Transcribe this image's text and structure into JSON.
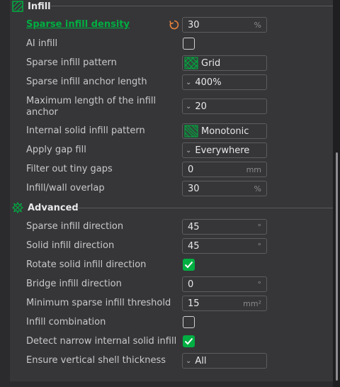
{
  "infill_section": {
    "title": "Infill",
    "accent": "#00ae42",
    "icon": "infill-section-icon"
  },
  "advanced_section": {
    "title": "Advanced",
    "icon": "advanced-section-icon"
  },
  "rows": {
    "sparse_density": {
      "label": "Sparse infill density",
      "value": "30",
      "unit": "%"
    },
    "ai_infill": {
      "label": "AI infill",
      "checked": false
    },
    "sparse_pattern": {
      "label": "Sparse infill pattern",
      "value": "Grid"
    },
    "anchor_length": {
      "label": "Sparse infill anchor length",
      "value": "400%"
    },
    "max_anchor": {
      "label": "Maximum length of the infill anchor",
      "value": "20"
    },
    "internal_solid_pattern": {
      "label": "Internal solid infill pattern",
      "value": "Monotonic"
    },
    "gap_fill": {
      "label": "Apply gap fill",
      "value": "Everywhere"
    },
    "tiny_gaps": {
      "label": "Filter out tiny gaps",
      "value": "0",
      "unit": "mm"
    },
    "wall_overlap": {
      "label": "Infill/wall overlap",
      "value": "30",
      "unit": "%"
    },
    "sparse_direction": {
      "label": "Sparse infill direction",
      "value": "45",
      "unit": "°"
    },
    "solid_direction": {
      "label": "Solid infill direction",
      "value": "45",
      "unit": "°"
    },
    "rotate_solid": {
      "label": "Rotate solid infill direction",
      "checked": true
    },
    "bridge_direction": {
      "label": "Bridge infill direction",
      "value": "0",
      "unit": "°"
    },
    "min_sparse_threshold": {
      "label": "Minimum sparse infill threshold",
      "value": "15",
      "unit": "mm²"
    },
    "infill_combination": {
      "label": "Infill combination",
      "checked": false
    },
    "detect_narrow": {
      "label": "Detect narrow internal solid infill",
      "checked": true
    },
    "vertical_shell": {
      "label": "Ensure vertical shell thickness",
      "value": "All"
    }
  }
}
